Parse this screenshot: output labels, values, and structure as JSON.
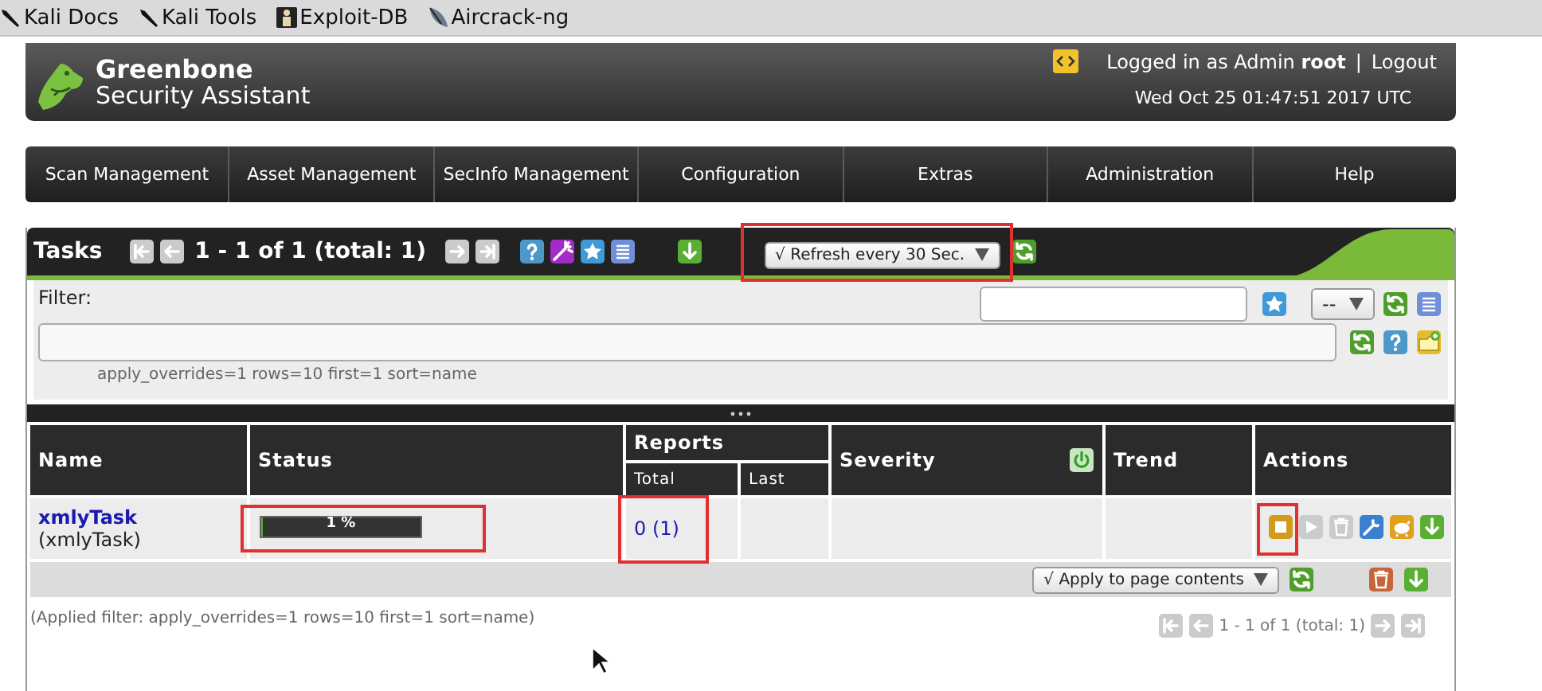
{
  "bookmarks": [
    {
      "label": "Kali Docs",
      "kind": "tool"
    },
    {
      "label": "Kali Tools",
      "kind": "tool"
    },
    {
      "label": "Exploit-DB",
      "kind": "exploit"
    },
    {
      "label": "Aircrack-ng",
      "kind": "dish"
    }
  ],
  "header": {
    "brand_line1": "Greenbone",
    "brand_line2": "Security Assistant",
    "login_prefix": "Logged in as Admin",
    "user": "root",
    "separator": "|",
    "logout": "Logout",
    "datetime": "Wed Oct 25 01:47:51 2017 UTC"
  },
  "menu": [
    "Scan Management",
    "Asset Management",
    "SecInfo Management",
    "Configuration",
    "Extras",
    "Administration",
    "Help"
  ],
  "tasks": {
    "title": "Tasks",
    "pager_before": [
      {
        "kind": "first",
        "disabled": true
      },
      {
        "kind": "prev",
        "disabled": true
      }
    ],
    "pager": "1 - 1 of 1 (total: 1)",
    "pager_after": [
      {
        "kind": "next",
        "disabled": true
      },
      {
        "kind": "last",
        "disabled": true
      }
    ],
    "tools": [
      {
        "kind": "help",
        "disabled": false
      },
      {
        "kind": "wizard",
        "disabled": false
      },
      {
        "kind": "star",
        "disabled": false
      },
      {
        "kind": "list",
        "disabled": false
      }
    ],
    "export": {
      "kind": "download",
      "disabled": false
    },
    "refresh": {
      "value": "√ Refresh every 30 Sec.",
      "highlighted": true
    },
    "refresh_button": {
      "kind": "refresh",
      "disabled": false
    }
  },
  "filter": {
    "label": "Filter:",
    "select": "--",
    "hint": "apply_overrides=1 rows=10 first=1 sort=name",
    "row1_icons": [
      {
        "kind": "refresh",
        "disabled": false
      },
      {
        "kind": "list",
        "disabled": false
      }
    ],
    "name_icon": {
      "kind": "star",
      "disabled": false
    },
    "row2_icons": [
      {
        "kind": "refresh",
        "disabled": false
      },
      {
        "kind": "help",
        "disabled": false
      },
      {
        "kind": "new",
        "disabled": false
      }
    ]
  },
  "table": {
    "columns": {
      "name": "Name",
      "status": "Status",
      "reports": "Reports",
      "total": "Total",
      "last": "Last",
      "severity": "Severity",
      "trend": "Trend",
      "actions": "Actions"
    },
    "severity_icon": {
      "kind": "power",
      "disabled": false
    },
    "rows": [
      {
        "name": "xmlyTask",
        "comment": "(xmlyTask)",
        "status": {
          "label": "1 %",
          "level": 0.01,
          "highlighted": true
        },
        "total": {
          "text": "0 (1)",
          "highlighted": true
        },
        "actions": [
          {
            "kind": "stop",
            "disabled": false,
            "highlighted": true
          },
          {
            "kind": "resume",
            "disabled": true,
            "highlighted": false
          },
          {
            "kind": "trash",
            "disabled": true,
            "highlighted": false
          },
          {
            "kind": "edit",
            "disabled": false,
            "highlighted": false
          },
          {
            "kind": "pig",
            "disabled": false,
            "highlighted": false
          },
          {
            "kind": "download",
            "disabled": false,
            "highlighted": false
          }
        ]
      }
    ],
    "footer": {
      "select": "√ Apply to page contents",
      "icons": [
        {
          "kind": "refresh",
          "disabled": false
        }
      ],
      "end_icons": [
        {
          "kind": "trash",
          "disabled": false
        },
        {
          "kind": "download",
          "disabled": false
        }
      ]
    }
  },
  "applied_filter": "(Applied filter: apply_overrides=1 rows=10 first=1 sort=name)",
  "bottom_pager": {
    "before": [
      {
        "kind": "first",
        "disabled": true
      },
      {
        "kind": "prev",
        "disabled": true
      }
    ],
    "text": "1 - 1 of 1 (total: 1)",
    "after": [
      {
        "kind": "next",
        "disabled": true
      },
      {
        "kind": "last",
        "disabled": true
      }
    ]
  }
}
